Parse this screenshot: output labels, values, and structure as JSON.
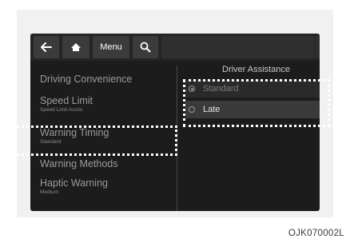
{
  "topbar": {
    "back_icon": "back-arrow-icon",
    "home_icon": "home-icon",
    "menu_label": "Menu",
    "search_icon": "search-icon"
  },
  "left_menu": {
    "items": [
      {
        "label": "Driving Convenience",
        "sub": ""
      },
      {
        "label": "Speed Limit",
        "sub": "Speed Limit Assist"
      },
      {
        "label": "Warning Timing",
        "sub": "Standard"
      },
      {
        "label": "Warning Methods",
        "sub": ""
      },
      {
        "label": "Haptic Warning",
        "sub": "Medium"
      }
    ]
  },
  "right_pane": {
    "title": "Driver Assistance",
    "options": [
      {
        "label": "Standard",
        "selected": true
      },
      {
        "label": "Late",
        "selected": false
      }
    ]
  },
  "figure_code": "OJK070002L"
}
